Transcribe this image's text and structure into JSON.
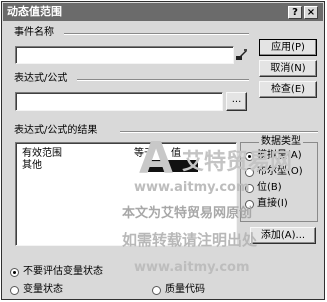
{
  "dialog": {
    "title": "动态值范围",
    "help_label": "?",
    "close_label": "×"
  },
  "event_name": {
    "label": "事件名称",
    "value": ""
  },
  "expression": {
    "label": "表达式/公式",
    "value": "",
    "browse_label": "..."
  },
  "results": {
    "label": "表达式/公式的结果",
    "columns": [
      "有效范围",
      "等于",
      "值"
    ],
    "rows": [
      {
        "range": "其他",
        "equals": "",
        "value": ""
      }
    ]
  },
  "data_type": {
    "label": "数据类型",
    "options": [
      "模拟量(A)",
      "布尔型(O)",
      "位(B)",
      "直接(I)"
    ]
  },
  "buttons": {
    "apply": "应用(P)",
    "cancel": "取消(N)",
    "check": "检查(E)",
    "add": "添加(A)..."
  },
  "bottom": {
    "no_eval": "不要评估变量状态",
    "var_status": "变量状态",
    "quality_code": "质量代码"
  },
  "watermark": {
    "brand_name": "艾特贸易网",
    "url": "www.aitmy.com",
    "line1": "本文为艾特贸易网原创",
    "line2": "如需转载请注明出处"
  }
}
